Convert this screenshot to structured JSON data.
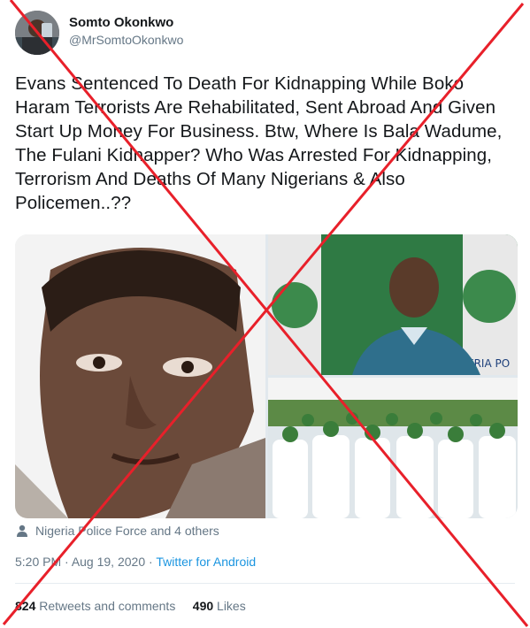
{
  "author": {
    "display_name": "Somto Okonkwo",
    "handle": "@MrSomtoOkonkwo"
  },
  "tweet": {
    "text": "Evans Sentenced To Death For Kidnapping While Boko Haram Terrorists Are Rehabilitated, Sent Abroad And Given Start Up Money For Business. Btw, Where Is Bala Wadume, The Fulani Kidnapper? Who Was Arrested For Kidnapping, Terrorism And Deaths Of Many Nigerians & Also Policemen..??"
  },
  "media": {
    "images": [
      "crying-man-photo",
      "police-suspect-photo",
      "rehabilitated-group-photo"
    ]
  },
  "tagged": {
    "icon": "person-icon",
    "text": "Nigeria Police Force and 4 others"
  },
  "meta": {
    "time": "5:20 PM",
    "separator1": " · ",
    "date": "Aug 19, 2020",
    "separator2": " · ",
    "source": "Twitter for Android"
  },
  "stats": {
    "retweets_count": "824",
    "retweets_label": " Retweets and comments",
    "likes_count": "490",
    "likes_label": " Likes"
  },
  "overlay": {
    "cross_color": "#e8202a"
  },
  "colors": {
    "secondary_text": "#657786",
    "link": "#1b95e0",
    "primary_text": "#14171a"
  }
}
